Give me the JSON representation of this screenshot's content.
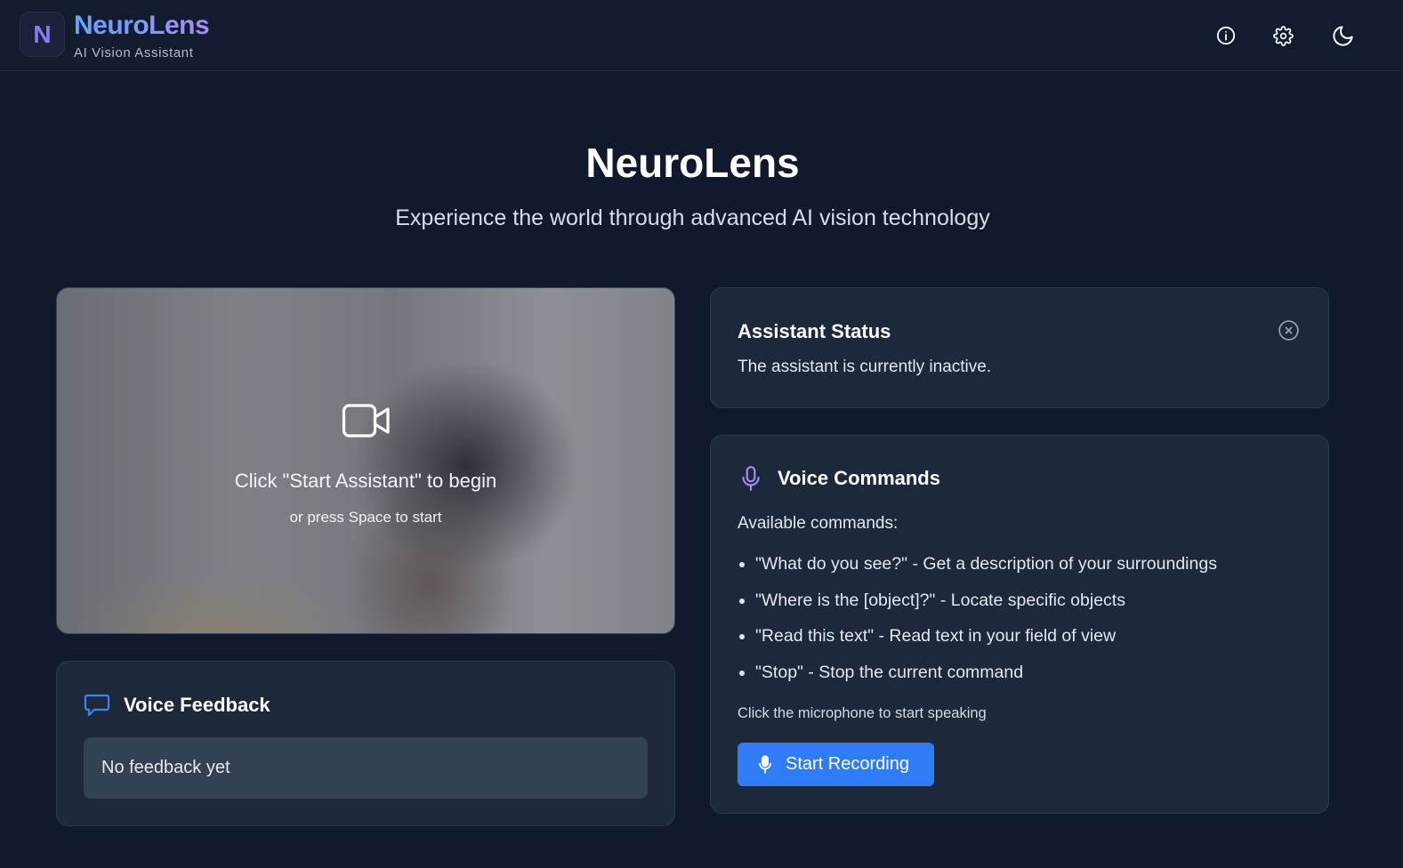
{
  "header": {
    "logo_letter": "N",
    "brand_name": "NeuroLens",
    "brand_subtitle": "AI Vision Assistant",
    "icons": [
      "info-icon",
      "gear-icon",
      "moon-icon"
    ]
  },
  "hero": {
    "title": "NeuroLens",
    "subtitle": "Experience the world through advanced AI vision technology"
  },
  "camera": {
    "icon": "video-camera-icon",
    "title": "Click \"Start Assistant\" to begin",
    "subtitle": "or press Space to start"
  },
  "status_card": {
    "title": "Assistant Status",
    "text": "The assistant is currently inactive.",
    "icon": "close-circle-icon"
  },
  "feedback_card": {
    "icon": "chat-bubble-icon",
    "title": "Voice Feedback",
    "text": "No feedback yet"
  },
  "commands_card": {
    "icon": "microphone-icon",
    "title": "Voice Commands",
    "intro": "Available commands:",
    "commands": [
      "\"What do you see?\" - Get a description of your surroundings",
      "\"Where is the [object]?\" - Locate specific objects",
      "\"Read this text\" - Read text in your field of view",
      "\"Stop\" - Stop the current command"
    ],
    "hint": "Click the microphone to start speaking",
    "button_label": "Start Recording"
  },
  "colors": {
    "background": "#111a2c",
    "card": "#1d283b",
    "accent_blue": "#2f7cf6",
    "accent_purple": "#a78bfa"
  }
}
